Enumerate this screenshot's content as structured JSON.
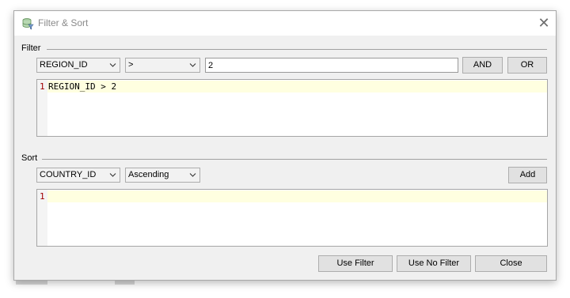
{
  "dialog": {
    "title": "Filter & Sort",
    "close_glyph": "✕",
    "icon": "filter-sort-icon"
  },
  "filter": {
    "section_label": "Filter",
    "column_select": "REGION_ID",
    "operator_select": ">",
    "value_input": "2",
    "and_label": "AND",
    "or_label": "OR",
    "editor": {
      "line_number": "1",
      "text": "REGION_ID > 2"
    }
  },
  "sort": {
    "section_label": "Sort",
    "column_select": "COUNTRY_ID",
    "order_select": "Ascending",
    "add_label": "Add",
    "editor": {
      "line_number": "1",
      "text": ""
    }
  },
  "footer": {
    "use_filter_label": "Use Filter",
    "use_no_filter_label": "Use No Filter",
    "close_label": "Close"
  }
}
